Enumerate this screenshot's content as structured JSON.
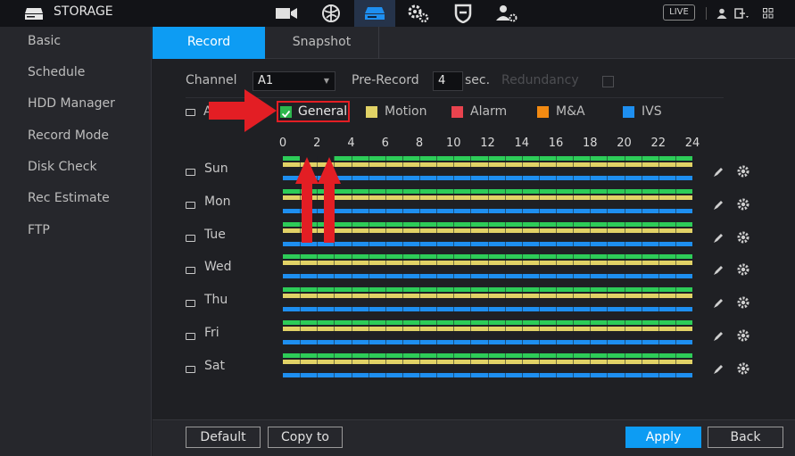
{
  "app": {
    "title": "STORAGE",
    "logo_icon": "storage-drive-icon"
  },
  "topbar": {
    "icons": [
      "camera-icon",
      "network-globe-icon",
      "storage-icon",
      "system-settings-icon",
      "shield-icon",
      "account-icon"
    ],
    "active_icon": "storage-icon",
    "live_label": "LIVE",
    "right_icons": [
      "user-icon",
      "logout-icon",
      "grid-icon"
    ]
  },
  "sidebar": {
    "items": [
      {
        "label": "Basic"
      },
      {
        "label": "Schedule"
      },
      {
        "label": "HDD Manager"
      },
      {
        "label": "Record Mode"
      },
      {
        "label": "Disk Check"
      },
      {
        "label": "Rec Estimate"
      },
      {
        "label": "FTP"
      }
    ]
  },
  "tabs": [
    {
      "label": "Record",
      "active": true
    },
    {
      "label": "Snapshot",
      "active": false
    }
  ],
  "form": {
    "channel_label": "Channel",
    "channel_value": "A1",
    "prerecord_label": "Pre-Record",
    "prerecord_value": "4",
    "prerecord_unit": "sec.",
    "redundancy_label": "Redundancy",
    "all_label": "A"
  },
  "legend": [
    {
      "label": "General",
      "color": "#2dcc58",
      "checked": true
    },
    {
      "label": "Motion",
      "color": "#e1d266"
    },
    {
      "label": "Alarm",
      "color": "#e8434e"
    },
    {
      "label": "M&A",
      "color": "#f28a12"
    },
    {
      "label": "IVS",
      "color": "#1e8ff0"
    }
  ],
  "hours": [
    "0",
    "2",
    "4",
    "6",
    "8",
    "10",
    "12",
    "14",
    "16",
    "18",
    "20",
    "22",
    "24"
  ],
  "days": [
    {
      "label": "Sun",
      "general_gap_hours": [
        1,
        3
      ]
    },
    {
      "label": "Mon"
    },
    {
      "label": "Tue"
    },
    {
      "label": "Wed"
    },
    {
      "label": "Thu"
    },
    {
      "label": "Fri"
    },
    {
      "label": "Sat"
    }
  ],
  "row_icons": [
    "copy-pencil-icon",
    "gear-icon"
  ],
  "bottom": {
    "default_label": "Default",
    "copyto_label": "Copy to",
    "apply_label": "Apply",
    "back_label": "Back"
  },
  "colors": {
    "accent": "#0d9cf3",
    "annotation": "#e31e24"
  }
}
